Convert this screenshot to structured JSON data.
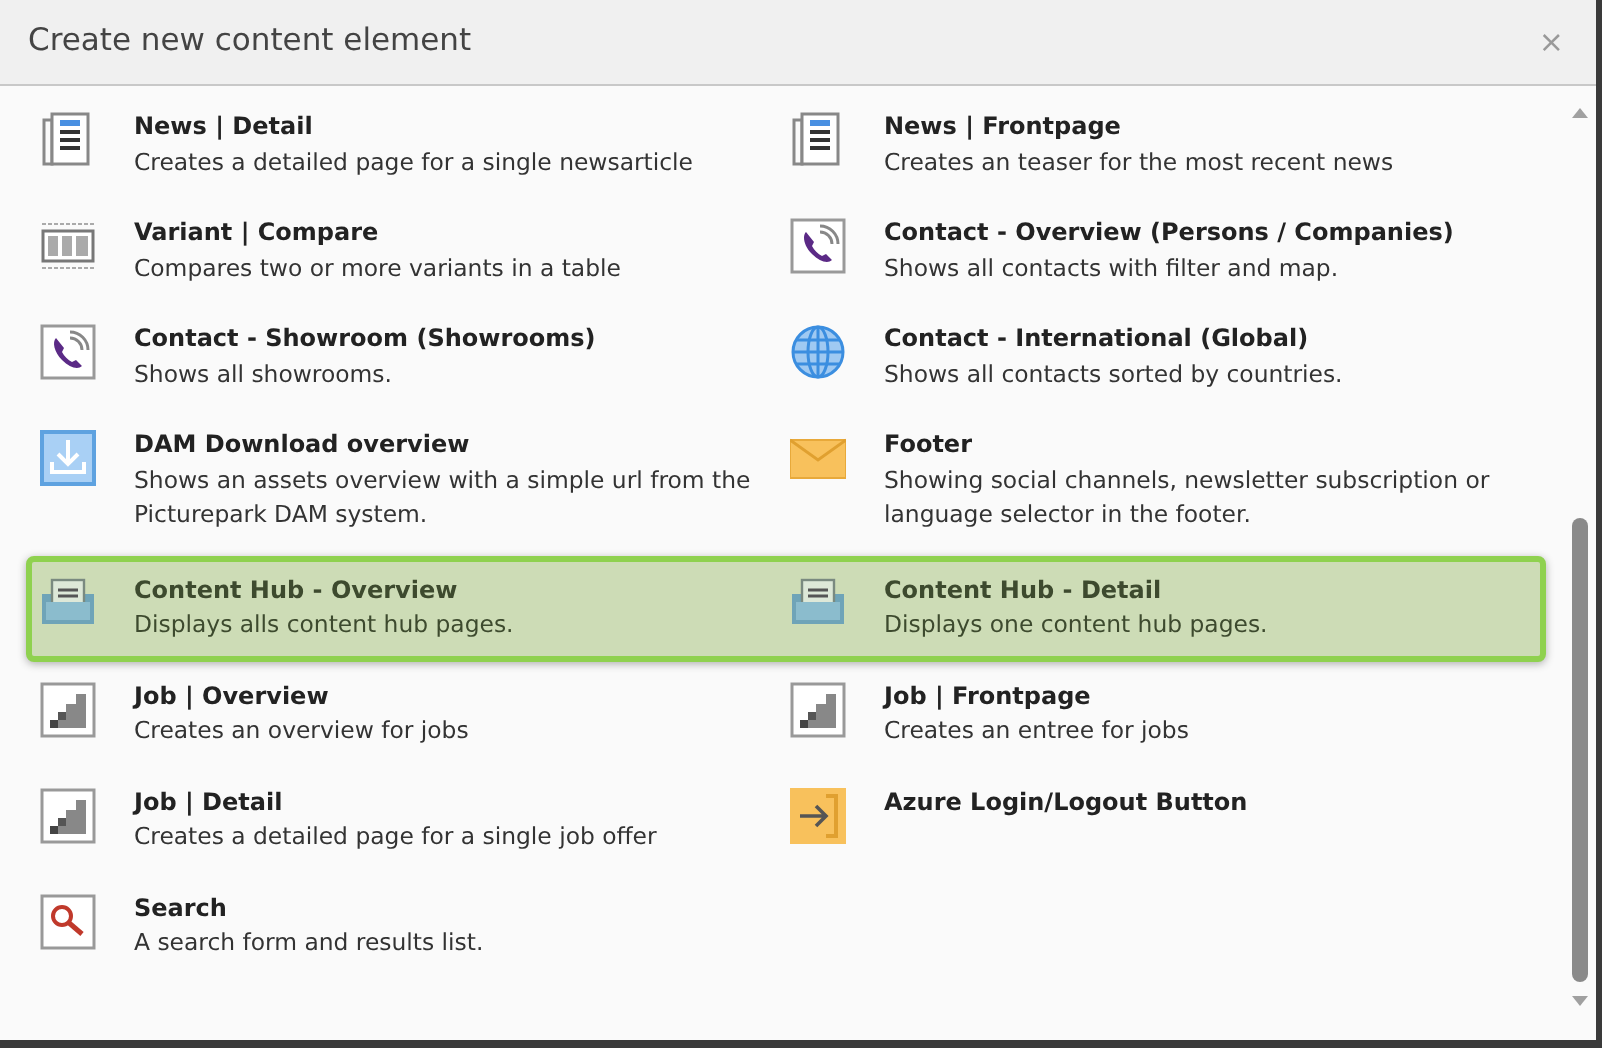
{
  "dialog": {
    "title": "Create new content element",
    "close": "×"
  },
  "rows": [
    {
      "highlighted": false,
      "items": [
        {
          "kind": "news",
          "title": "News | Detail",
          "description": "Creates a detailed page for a single newsarticle"
        },
        {
          "kind": "news",
          "title": "News | Frontpage",
          "description": "Creates an teaser for the most recent news"
        }
      ]
    },
    {
      "highlighted": false,
      "items": [
        {
          "kind": "variant",
          "title": "Variant | Compare",
          "description": "Compares two or more variants in a table"
        },
        {
          "kind": "phone",
          "title": "Contact - Overview (Persons / Companies)",
          "description": "Shows all contacts with filter and map."
        }
      ]
    },
    {
      "highlighted": false,
      "items": [
        {
          "kind": "phone",
          "title": "Contact - Showroom (Showrooms)",
          "description": "Shows all showrooms."
        },
        {
          "kind": "globe",
          "title": "Contact - International (Global)",
          "description": "Shows all contacts sorted by countries."
        }
      ]
    },
    {
      "highlighted": false,
      "items": [
        {
          "kind": "download",
          "title": "DAM Download overview",
          "description": "Shows an assets overview with a simple url from the Picturepark DAM system."
        },
        {
          "kind": "envelope",
          "title": "Footer",
          "description": "Showing social channels, newsletter subscription or language selector in the footer."
        }
      ]
    },
    {
      "highlighted": true,
      "items": [
        {
          "kind": "hub",
          "title": "Content Hub - Overview",
          "description": "Displays alls content hub pages."
        },
        {
          "kind": "hub",
          "title": "Content Hub - Detail",
          "description": "Displays one content hub pages."
        }
      ]
    },
    {
      "highlighted": false,
      "items": [
        {
          "kind": "job",
          "title": "Job | Overview",
          "description": "Creates an overview for jobs"
        },
        {
          "kind": "job",
          "title": "Job | Frontpage",
          "description": "Creates an entree for jobs"
        }
      ]
    },
    {
      "highlighted": false,
      "items": [
        {
          "kind": "job",
          "title": "Job | Detail",
          "description": "Creates a detailed page for a single job offer"
        },
        {
          "kind": "login",
          "title": "Azure Login/Logout Button"
        }
      ]
    },
    {
      "highlighted": false,
      "items": [
        {
          "kind": "search",
          "title": "Search",
          "description": "A search form and results list."
        }
      ]
    }
  ]
}
